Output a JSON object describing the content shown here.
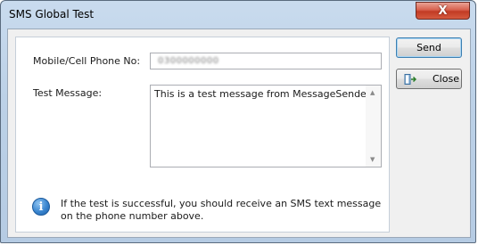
{
  "window": {
    "title": "SMS Global Test",
    "close_glyph": "X"
  },
  "form": {
    "phone_label": "Mobile/Cell Phone No:",
    "phone_value": "0300000000",
    "message_label": "Test Message:",
    "message_value": "This is a test message from MessageSender."
  },
  "info": {
    "icon": "info-icon",
    "glyph": "i",
    "text": "If the test is successful, you should receive an SMS text message on the phone number above."
  },
  "buttons": {
    "send_label": "Send",
    "close_label": "Close",
    "close_icon": "exit-door-icon"
  },
  "scrollbar": {
    "up_glyph": "▲",
    "down_glyph": "▼"
  }
}
